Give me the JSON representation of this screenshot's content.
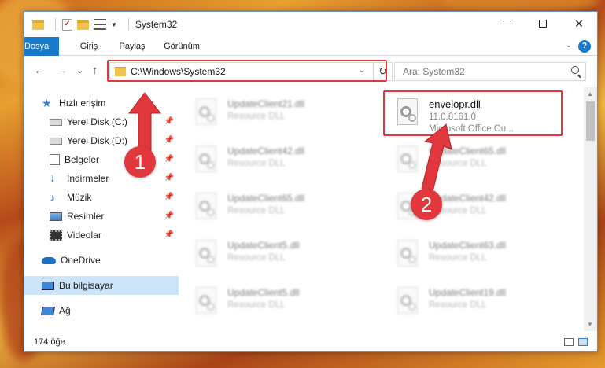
{
  "window": {
    "title": "System32",
    "controls": {
      "minimize": "–",
      "maximize": "□",
      "close": "✕"
    }
  },
  "ribbon": {
    "tabs": [
      "Dosya",
      "Giriş",
      "Paylaş",
      "Görünüm"
    ],
    "help_label": "?"
  },
  "nav": {
    "address": "C:\\Windows\\System32",
    "search_placeholder": "Ara: System32",
    "back_glyph": "←",
    "forward_glyph": "→",
    "recent_glyph": "⌄",
    "up_glyph": "↑",
    "refresh_glyph": "↻"
  },
  "sidebar": {
    "items": [
      {
        "label": "Hızlı erişim",
        "icon": "star-icon",
        "pinned": false
      },
      {
        "label": "Yerel Disk (C:)",
        "icon": "drive-icon",
        "pinned": true
      },
      {
        "label": "Yerel Disk (D:)",
        "icon": "drive-icon",
        "pinned": true
      },
      {
        "label": "Belgeler",
        "icon": "documents-icon",
        "pinned": true
      },
      {
        "label": "İndirmeler",
        "icon": "downloads-icon",
        "pinned": true
      },
      {
        "label": "Müzik",
        "icon": "music-icon",
        "pinned": true
      },
      {
        "label": "Resimler",
        "icon": "pictures-icon",
        "pinned": true
      },
      {
        "label": "Videolar",
        "icon": "videos-icon",
        "pinned": true
      },
      {
        "label": "OneDrive",
        "icon": "cloud-icon",
        "pinned": false
      },
      {
        "label": "Bu bilgisayar",
        "icon": "computer-icon",
        "pinned": false,
        "selected": true
      },
      {
        "label": "Ağ",
        "icon": "network-icon",
        "pinned": false
      }
    ]
  },
  "files": {
    "left_column": [
      {
        "name": "UpdateClient21.dll",
        "desc": "Resource DLL"
      },
      {
        "name": "UpdateClient42.dll",
        "desc": "Resource DLL"
      },
      {
        "name": "UpdateClient65.dll",
        "desc": "Resource DLL"
      },
      {
        "name": "UpdateClient5.dll",
        "desc": "Resource DLL"
      },
      {
        "name": "UpdateClient5.dll",
        "desc": "Resource DLL"
      }
    ],
    "right_column": [
      {
        "name": "envelopr.dll",
        "version": "11.0.8161.0",
        "desc": "Microsoft Office Ou..."
      },
      {
        "name": "UpdateClient65.dll",
        "desc": "Resource DLL"
      },
      {
        "name": "UpdateClient42.dll",
        "desc": "Resource DLL"
      },
      {
        "name": "UpdateClient63.dll",
        "desc": "Resource DLL"
      },
      {
        "name": "UpdateClient19.dll",
        "desc": "Resource DLL"
      }
    ]
  },
  "status": {
    "count": "174 öğe"
  },
  "annotations": {
    "badge1": "1",
    "badge2": "2",
    "color": "#e2373c"
  }
}
